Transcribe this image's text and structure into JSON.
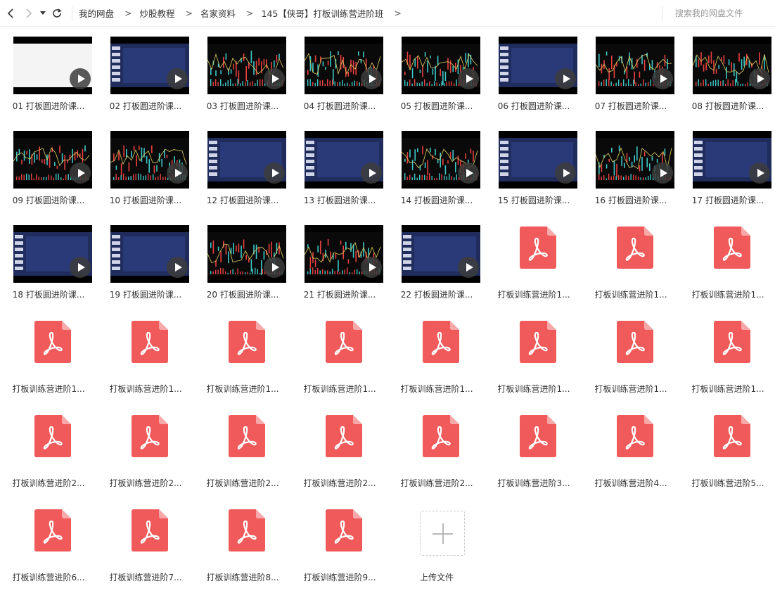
{
  "toolbar": {
    "back_icon": "chevron-left-icon",
    "forward_icon": "chevron-right-icon",
    "history_icon": "caret-down-icon",
    "refresh_icon": "refresh-icon"
  },
  "breadcrumb": [
    "我的网盘",
    "炒股教程",
    "名家资料",
    "145【侠哥】打板训练营进阶班"
  ],
  "breadcrumb_separator": ">",
  "search": {
    "placeholder": "搜索我的网盘文件"
  },
  "colors": {
    "pdf": "#f05a5a",
    "thumb_bg": "#000000",
    "slide_blue": "#1f2c5c"
  },
  "videos": [
    {
      "label": "01 打板圆进阶课...",
      "screen": "doc"
    },
    {
      "label": "02 打板圆进阶课...",
      "screen": "blue"
    },
    {
      "label": "03 打板圆进阶课...",
      "screen": "dark"
    },
    {
      "label": "04 打板圆进阶课...",
      "screen": "dark"
    },
    {
      "label": "05 打板圆进阶课...",
      "screen": "dark"
    },
    {
      "label": "06 打板圆进阶课...",
      "screen": "blue"
    },
    {
      "label": "07 打板圆进阶课...",
      "screen": "dark"
    },
    {
      "label": "08 打板圆进阶课...",
      "screen": "dark"
    },
    {
      "label": "09 打板圆进阶课...",
      "screen": "dark"
    },
    {
      "label": "10 打板圆进阶课...",
      "screen": "dark"
    },
    {
      "label": "12 打板圆进阶课...",
      "screen": "blue"
    },
    {
      "label": "13 打板圆进阶课...",
      "screen": "blue"
    },
    {
      "label": "14 打板圆进阶课...",
      "screen": "dark"
    },
    {
      "label": "15 打板圆进阶课...",
      "screen": "blue"
    },
    {
      "label": "16 打板圆进阶课...",
      "screen": "dark"
    },
    {
      "label": "17 打板圆进阶课...",
      "screen": "blue"
    },
    {
      "label": "18 打板圆进阶课...",
      "screen": "blue"
    },
    {
      "label": "19 打板圆进阶课...",
      "screen": "blue"
    },
    {
      "label": "20 打板圆进阶课...",
      "screen": "dark"
    },
    {
      "label": "21 打板圆进阶课...",
      "screen": "dark"
    },
    {
      "label": "22 打板圆进阶课...",
      "screen": "blue"
    }
  ],
  "pdfs": [
    "打板训练营进阶1...",
    "打板训练营进阶1...",
    "打板训练营进阶1...",
    "打板训练营进阶1...",
    "打板训练营进阶1...",
    "打板训练营进阶1...",
    "打板训练营进阶1...",
    "打板训练营进阶1...",
    "打板训练营进阶1...",
    "打板训练营进阶1...",
    "打板训练营进阶1...",
    "打板训练营进阶2...",
    "打板训练营进阶2...",
    "打板训练营进阶2...",
    "打板训练营进阶2...",
    "打板训练营进阶2...",
    "打板训练营进阶3...",
    "打板训练营进阶4...",
    "打板训练营进阶5...",
    "打板训练营进阶6...",
    "打板训练营进阶7...",
    "打板训练营进阶8...",
    "打板训练营进阶9..."
  ],
  "upload": {
    "label": "上传文件"
  }
}
